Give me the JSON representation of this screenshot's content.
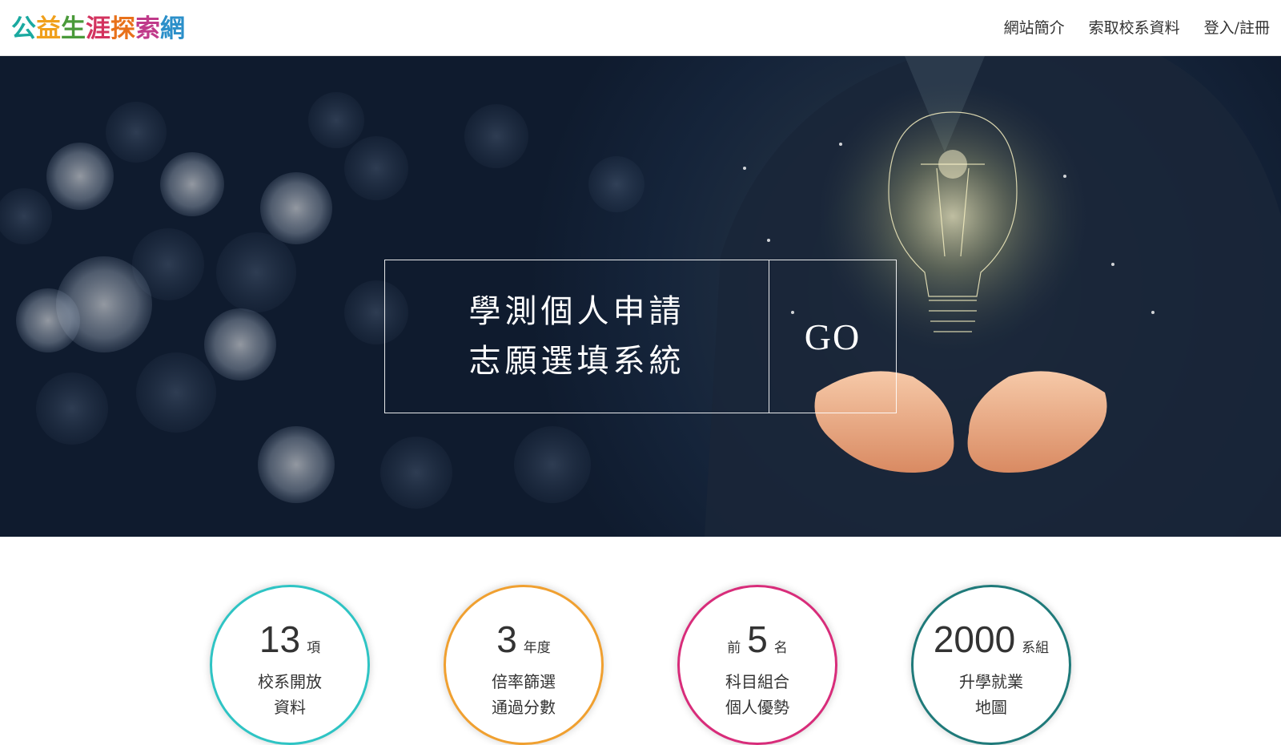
{
  "header": {
    "logo_chars": [
      {
        "char": "公",
        "color": "#1aa9a0"
      },
      {
        "char": "益",
        "color": "#f0a01c"
      },
      {
        "char": "生",
        "color": "#4a9a3a"
      },
      {
        "char": "涯",
        "color": "#d3335f"
      },
      {
        "char": "探",
        "color": "#e8711a"
      },
      {
        "char": "索",
        "color": "#c03a8a"
      },
      {
        "char": "網",
        "color": "#2b8fc9"
      }
    ],
    "nav": [
      "網站簡介",
      "索取校系資料",
      "登入/註冊"
    ]
  },
  "hero": {
    "title_line1": "學測個人申請",
    "title_line2": "志願選填系統",
    "go_label": "GO"
  },
  "stats": [
    {
      "prefix": "",
      "number": "13",
      "unit": "項",
      "line1": "校系開放",
      "line2": "資料",
      "color": "#2ec4c4"
    },
    {
      "prefix": "",
      "number": "3",
      "unit": "年度",
      "line1": "倍率篩選",
      "line2": "通過分數",
      "color": "#f0a030"
    },
    {
      "prefix": "前",
      "number": "5",
      "unit": "名",
      "line1": "科目組合",
      "line2": "個人優勢",
      "color": "#d82c7a"
    },
    {
      "prefix": "",
      "number": "2000",
      "unit": "系組",
      "line1": "升學就業",
      "line2": "地圖",
      "color": "#1f7a7a"
    }
  ]
}
